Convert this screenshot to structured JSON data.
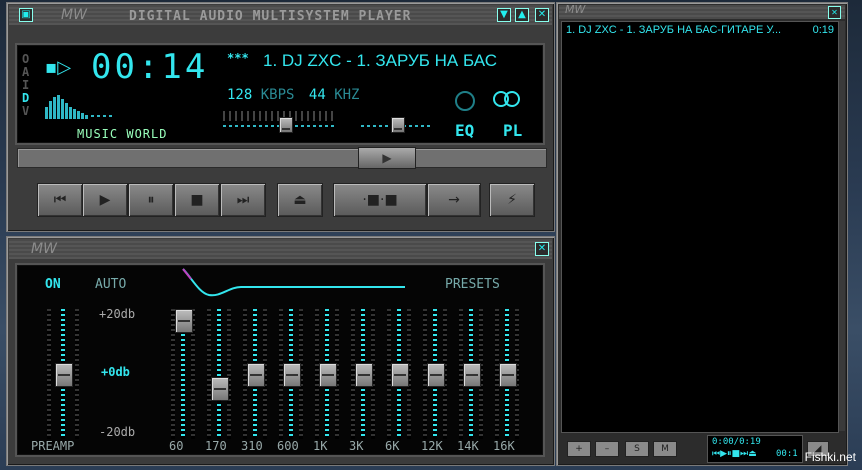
{
  "player": {
    "title": "DIGITAL AUDIO MULTISYSTEM PLAYER",
    "logo": "MW",
    "mode_letters": [
      "O",
      "A",
      "I",
      "D",
      "V"
    ],
    "time": "00:14",
    "track": "1. DJ ZXC - 1. ЗАРУБ НА БАС",
    "bitrate": "128",
    "bitrate_unit": "KBPS",
    "samplerate": "44",
    "samplerate_unit": "KHZ",
    "station": "MUSIC WORLD",
    "eq_button": "EQ",
    "pl_button": "PL",
    "stars": "***"
  },
  "controls": [
    "prev-icon",
    "play-icon",
    "pause-icon",
    "stop-icon",
    "next-icon",
    "eject-icon",
    "shuffle-icon",
    "repeat-icon",
    "lightning-icon"
  ],
  "equalizer": {
    "logo": "MW",
    "on_label": "ON",
    "auto_label": "AUTO",
    "presets_label": "PRESETS",
    "plus_label": "+20db",
    "zero_label": "+0db",
    "minus_label": "-20db",
    "preamp_label": "PREAMP",
    "bands": [
      "60",
      "170",
      "310",
      "600",
      "1K",
      "3K",
      "6K",
      "12K",
      "14K",
      "16K"
    ],
    "levels": [
      20,
      -5,
      0,
      0,
      0,
      0,
      0,
      0,
      0,
      0
    ],
    "preamp_level": 0
  },
  "playlist": {
    "logo": "MW",
    "items": [
      {
        "title": "1. DJ ZXC - 1. ЗАРУБ НА БАС-ГИТАРЕ У...",
        "duration": "0:19"
      }
    ],
    "buttons": [
      "+",
      "–",
      "S",
      "M"
    ],
    "time_display": "0:00/0:19",
    "mini_time": "00:1"
  },
  "watermark": "Fishki.net"
}
